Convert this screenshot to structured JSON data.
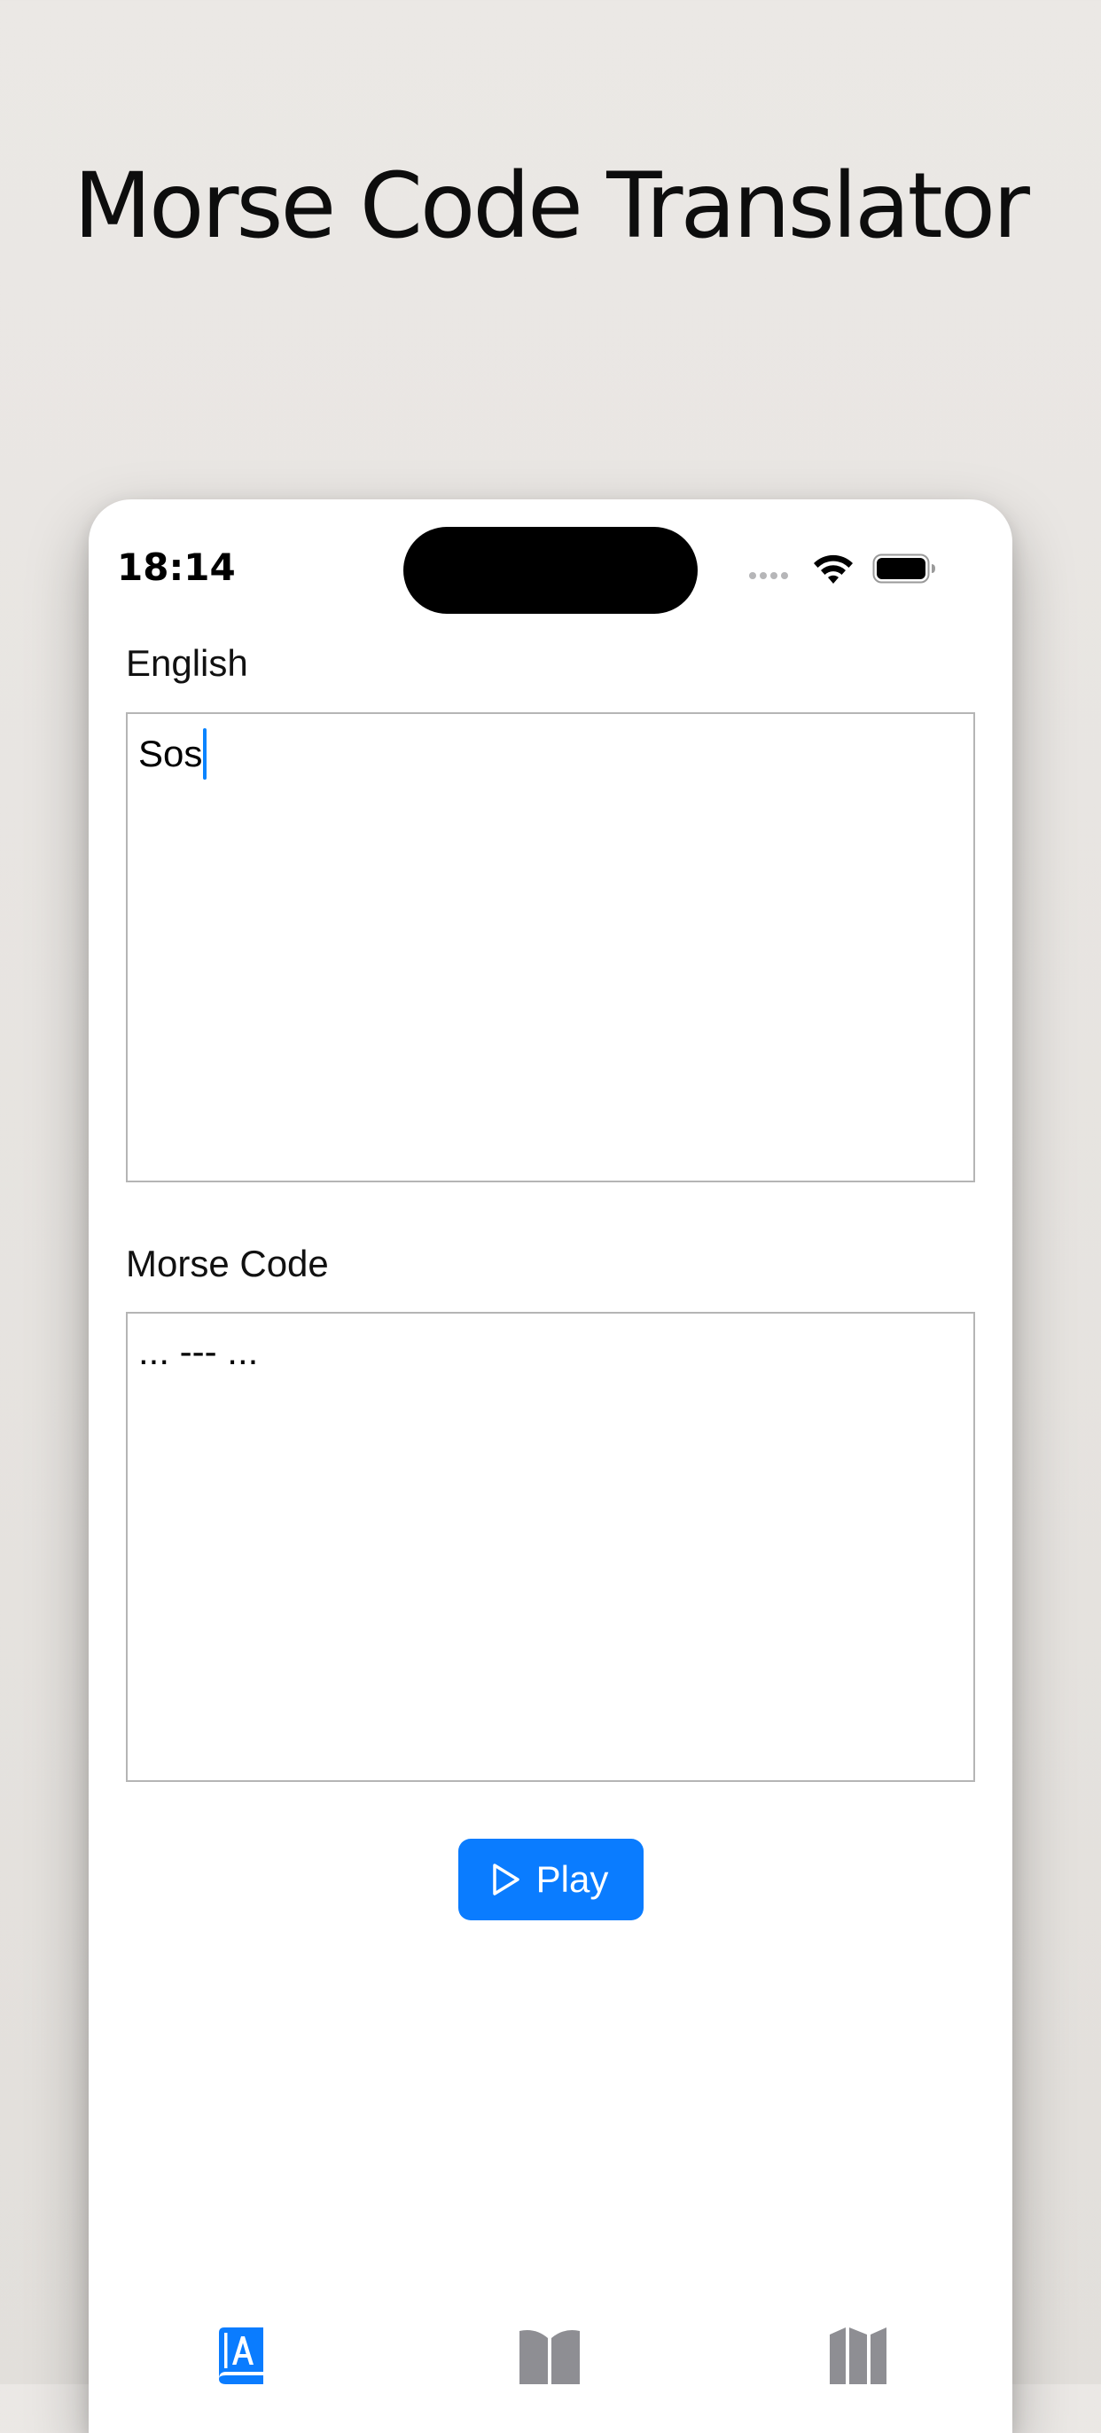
{
  "headline": "Morse Code Translator",
  "status_bar": {
    "time": "18:14"
  },
  "english": {
    "label": "English",
    "value": "Sos"
  },
  "morse": {
    "label": "Morse Code",
    "value": "... --- ..."
  },
  "play_button": {
    "label": "Play",
    "icon": "play-icon"
  },
  "tab_bar": {
    "items": [
      {
        "icon": "translate-book-icon",
        "active": true
      },
      {
        "icon": "open-book-icon",
        "active": false
      },
      {
        "icon": "map-icon",
        "active": false
      }
    ]
  },
  "colors": {
    "accent": "#0a7cff",
    "caret": "#0a84ff",
    "tab_inactive": "#8e8e93"
  }
}
